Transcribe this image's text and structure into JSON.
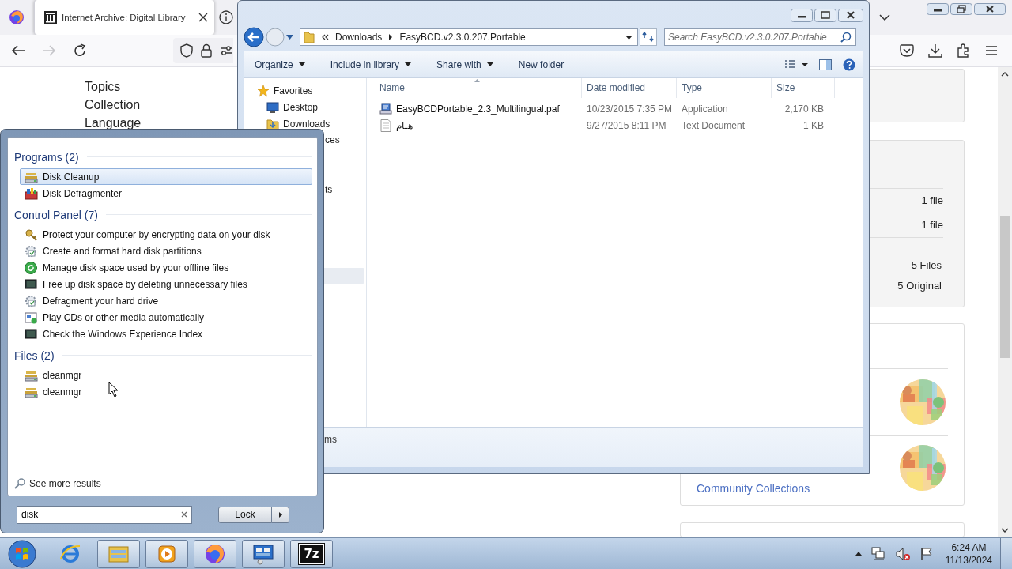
{
  "browser": {
    "tabs": [
      {
        "title": "Internet Archive: Digital Library",
        "selected": true
      }
    ],
    "nav_buttons": [
      {
        "kind": "back",
        "disabled": false
      },
      {
        "kind": "forward",
        "disabled": true
      },
      {
        "kind": "reload",
        "disabled": false
      }
    ],
    "sidebar_links": [
      "Topics",
      "Collection",
      "Language"
    ],
    "file_counts": [
      "1 file",
      "1 file"
    ],
    "totals": [
      "5 Files",
      "5 Original"
    ],
    "collections": [
      {
        "kind": "avatar"
      },
      {
        "kind": "avatar",
        "link": "Community Collections"
      }
    ]
  },
  "explorer": {
    "path": [
      "Downloads",
      "EasyBCD.v2.3.0.207.Portable"
    ],
    "search": {
      "placeholder": "Search EasyBCD.v2.3.0.207.Portable"
    },
    "toolbar": [
      {
        "label": "Organize",
        "dropdown": true
      },
      {
        "label": "Include in library",
        "dropdown": true
      },
      {
        "label": "Share with",
        "dropdown": true
      },
      {
        "label": "New folder",
        "dropdown": false
      }
    ],
    "nav_pane": [
      {
        "label": "Favorites",
        "kind": "favorites"
      },
      {
        "label": "Desktop",
        "kind": "desktop"
      },
      {
        "label": "Downloads",
        "kind": "downloads"
      }
    ],
    "nav_pane_fragments": [
      "ces",
      "ts"
    ],
    "columns": [
      "Name",
      "Date modified",
      "Type",
      "Size"
    ],
    "rows": [
      {
        "name": "EasyBCDPortable_2.3_Multilingual.paf",
        "kind": "application",
        "date": "10/23/2015 7:35 PM",
        "type": "Application",
        "size": "2,170 KB"
      },
      {
        "name": "هـام",
        "kind": "text",
        "date": "9/27/2015 8:11 PM",
        "type": "Text Document",
        "size": "1 KB"
      }
    ],
    "status_fragment": "ms"
  },
  "start_menu": {
    "groups": [
      {
        "heading": "Programs (2)",
        "items": [
          {
            "label": "Disk Cleanup",
            "kind": "drive",
            "selected": true
          },
          {
            "label": "Disk Defragmenter",
            "kind": "defrag",
            "selected": false
          }
        ]
      },
      {
        "heading": "Control Panel (7)",
        "items": [
          {
            "label": "Protect your computer by encrypting data on your disk",
            "kind": "keys",
            "selected": false
          },
          {
            "label": "Create and format hard disk partitions",
            "kind": "gear",
            "selected": false
          },
          {
            "label": "Manage disk space used by your offline files",
            "kind": "sync",
            "selected": false
          },
          {
            "label": "Free up disk space by deleting unnecessary files",
            "kind": "monitor",
            "selected": false
          },
          {
            "label": "Defragment your hard drive",
            "kind": "gear",
            "selected": false
          },
          {
            "label": "Play CDs or other media automatically",
            "kind": "media",
            "selected": false
          },
          {
            "label": "Check the Windows Experience Index",
            "kind": "monitor",
            "selected": false
          }
        ]
      },
      {
        "heading": "Files (2)",
        "items": [
          {
            "label": "cleanmgr",
            "kind": "drive",
            "selected": false
          },
          {
            "label": "cleanmgr",
            "kind": "drive",
            "selected": false
          }
        ]
      }
    ],
    "see_more": "See more results",
    "search": {
      "value": "disk"
    },
    "power_button": "Lock"
  },
  "taskbar": {
    "apps": [
      {
        "kind": "ie",
        "running": false
      },
      {
        "kind": "explorer",
        "running": true
      },
      {
        "kind": "media",
        "running": true
      },
      {
        "kind": "firefox",
        "running": true
      },
      {
        "kind": "control",
        "running": true
      },
      {
        "kind": "archiver",
        "running": true,
        "label": "7z"
      }
    ],
    "clock": {
      "time": "6:24 AM",
      "date": "11/13/2024"
    }
  }
}
